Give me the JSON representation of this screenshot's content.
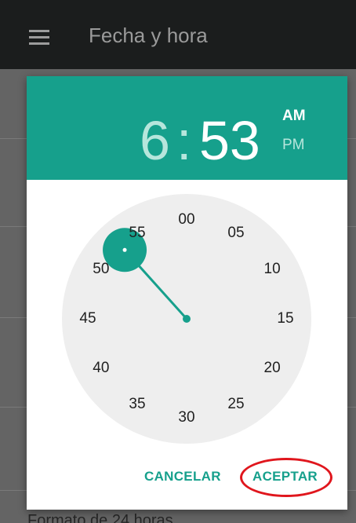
{
  "appbar": {
    "title": "Fecha y hora"
  },
  "background": {
    "footer_text": "Formato de 24 horas"
  },
  "dialog": {
    "time": {
      "hour": "6",
      "separator": ":",
      "minute": "53",
      "am": "AM",
      "pm": "PM",
      "selected_period": "AM"
    },
    "clock": {
      "numbers": [
        "00",
        "05",
        "10",
        "15",
        "20",
        "25",
        "30",
        "35",
        "40",
        "45",
        "50",
        "55"
      ],
      "selected_minute": 53
    },
    "actions": {
      "cancel": "CANCELAR",
      "accept": "ACEPTAR"
    },
    "colors": {
      "accent": "#16a08c",
      "highlight": "#e0161d"
    }
  }
}
